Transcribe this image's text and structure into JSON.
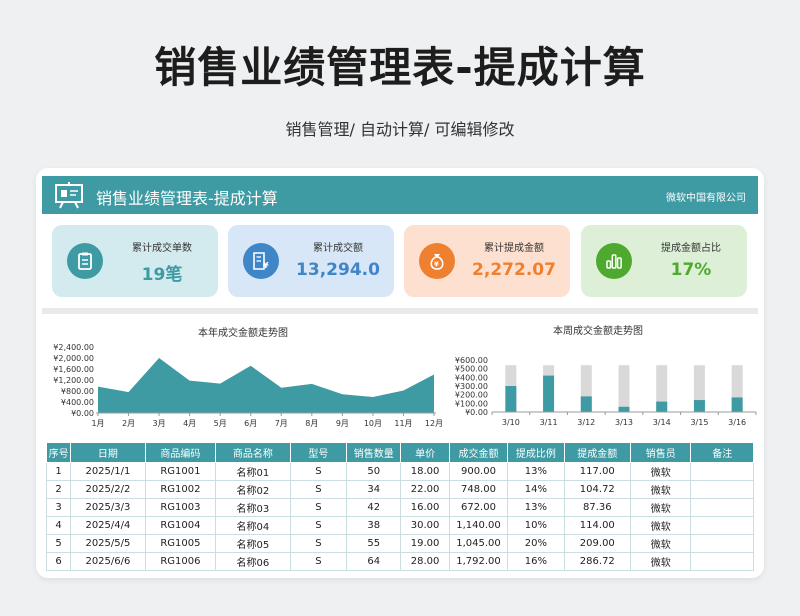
{
  "hero": {
    "title": "销售业绩管理表-提成计算",
    "subtitle": "销售管理/ 自动计算/ 可编辑修改"
  },
  "header": {
    "title": "销售业绩管理表-提成计算",
    "company": "微软中国有限公司",
    "icon": "presentation-board-icon"
  },
  "kpis": [
    {
      "label": "累计成交单数",
      "value": "19笔",
      "bg": "#d3ebee",
      "circle": "#3e9aa3",
      "value_color": "#3e9aa3",
      "icon": "clipboard-icon"
    },
    {
      "label": "累计成交额",
      "value": "13,294.0",
      "bg": "#d7e7f7",
      "circle": "#3f86c9",
      "value_color": "#3f86c9",
      "icon": "invoice-yen-icon"
    },
    {
      "label": "累计提成金额",
      "value": "2,272.07",
      "bg": "#fde0cf",
      "circle": "#ef8030",
      "value_color": "#ef8030",
      "icon": "money-bag-icon"
    },
    {
      "label": "提成金额占比",
      "value": "17%",
      "bg": "#ddf0d7",
      "circle": "#4ea92e",
      "value_color": "#4ea92e",
      "icon": "bar-chart-icon"
    }
  ],
  "chart_data": [
    {
      "type": "area",
      "title": "本年成交金额走势图",
      "categories": [
        "1月",
        "2月",
        "3月",
        "4月",
        "5月",
        "6月",
        "7月",
        "8月",
        "9月",
        "10月",
        "11月",
        "12月"
      ],
      "values": [
        960,
        760,
        2000,
        1180,
        1070,
        1720,
        920,
        1060,
        680,
        580,
        820,
        1400
      ],
      "ylim": [
        0,
        2400
      ],
      "yticks": [
        "¥2,400.00",
        "¥2,000.00",
        "¥1,600.00",
        "¥1,200.00",
        "¥800.00",
        "¥400.00",
        "¥0.00"
      ],
      "color": "#3e9aa3"
    },
    {
      "type": "bar",
      "title": "本周成交金额走势图",
      "categories": [
        "3/10",
        "3/11",
        "3/12",
        "3/13",
        "3/14",
        "3/15",
        "3/16"
      ],
      "series": [
        {
          "values": [
            500,
            700,
            300,
            100,
            200,
            230,
            280
          ],
          "color": "#3e9aa3"
        },
        {
          "values": [
            900,
            900,
            900,
            900,
            900,
            900,
            900
          ],
          "color": "#d9d9d9"
        }
      ],
      "ylim": [
        0,
        1000
      ],
      "yticks": [
        "¥600.00",
        "¥500.00",
        "¥400.00",
        "¥300.00",
        "¥200.00",
        "¥100.00",
        "¥0.00"
      ],
      "yticks_note": "",
      "grid": false
    }
  ],
  "table": {
    "headers": [
      "序号",
      "日期",
      "商品编码",
      "商品名称",
      "型号",
      "销售数量",
      "单价",
      "成交金额",
      "提成比例",
      "提成金额",
      "销售员",
      "备注"
    ],
    "rows": [
      [
        "1",
        "2025/1/1",
        "RG1001",
        "名称01",
        "S",
        "50",
        "18.00",
        "900.00",
        "13%",
        "117.00",
        "微软",
        ""
      ],
      [
        "2",
        "2025/2/2",
        "RG1002",
        "名称02",
        "S",
        "34",
        "22.00",
        "748.00",
        "14%",
        "104.72",
        "微软",
        ""
      ],
      [
        "3",
        "2025/3/3",
        "RG1003",
        "名称03",
        "S",
        "42",
        "16.00",
        "672.00",
        "13%",
        "87.36",
        "微软",
        ""
      ],
      [
        "4",
        "2025/4/4",
        "RG1004",
        "名称04",
        "S",
        "38",
        "30.00",
        "1,140.00",
        "10%",
        "114.00",
        "微软",
        ""
      ],
      [
        "5",
        "2025/5/5",
        "RG1005",
        "名称05",
        "S",
        "55",
        "19.00",
        "1,045.00",
        "20%",
        "209.00",
        "微软",
        ""
      ],
      [
        "6",
        "2025/6/6",
        "RG1006",
        "名称06",
        "S",
        "64",
        "28.00",
        "1,792.00",
        "16%",
        "286.72",
        "微软",
        ""
      ]
    ]
  }
}
